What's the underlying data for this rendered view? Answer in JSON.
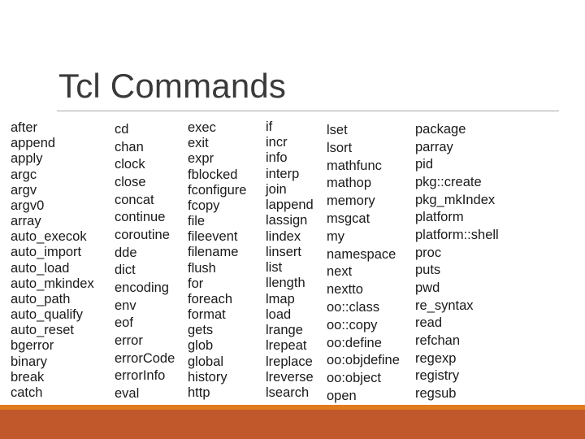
{
  "slide": {
    "title": "Tcl Commands",
    "columns": [
      [
        "after",
        "append",
        "apply",
        "argc",
        "argv",
        "argv0",
        "array",
        "auto_execok",
        "auto_import",
        "auto_load",
        "auto_mkindex",
        "auto_path",
        "auto_qualify",
        "auto_reset",
        "bgerror",
        "binary",
        "break",
        "catch"
      ],
      [
        "cd",
        "chan",
        "clock",
        "close",
        "concat",
        "continue",
        "coroutine",
        "dde",
        "dict",
        "encoding",
        "env",
        "eof",
        "error",
        "errorCode",
        "errorInfo",
        "eval"
      ],
      [
        "exec",
        "exit",
        "expr",
        "fblocked",
        "fconfigure",
        "fcopy",
        "file",
        "fileevent",
        "filename",
        "flush",
        "for",
        "foreach",
        "format",
        "gets",
        "glob",
        "global",
        "history",
        "http"
      ],
      [
        "if",
        "incr",
        "info",
        "interp",
        "join",
        "lappend",
        "lassign",
        "lindex",
        "linsert",
        "list",
        "llength",
        "lmap",
        "load",
        "lrange",
        "lrepeat",
        "lreplace",
        "lreverse",
        "lsearch"
      ],
      [
        "lset",
        "lsort",
        "mathfunc",
        "mathop",
        "memory",
        "msgcat",
        "my",
        "namespace",
        "next",
        "nextto",
        "oo::class",
        "oo::copy",
        "oo:define",
        "oo:objdefine",
        "oo:object",
        "open"
      ],
      [
        "package",
        "parray",
        "pid",
        "pkg::create",
        "pkg_mkIndex",
        "platform",
        "platform::shell",
        "proc",
        "puts",
        "pwd",
        "re_syntax",
        "read",
        "refchan",
        "regexp",
        "registry",
        "regsub"
      ]
    ]
  },
  "colors": {
    "accent_orange": "#e07b1e",
    "footer_rust": "#c0582c",
    "title": "#3a3a3a"
  }
}
